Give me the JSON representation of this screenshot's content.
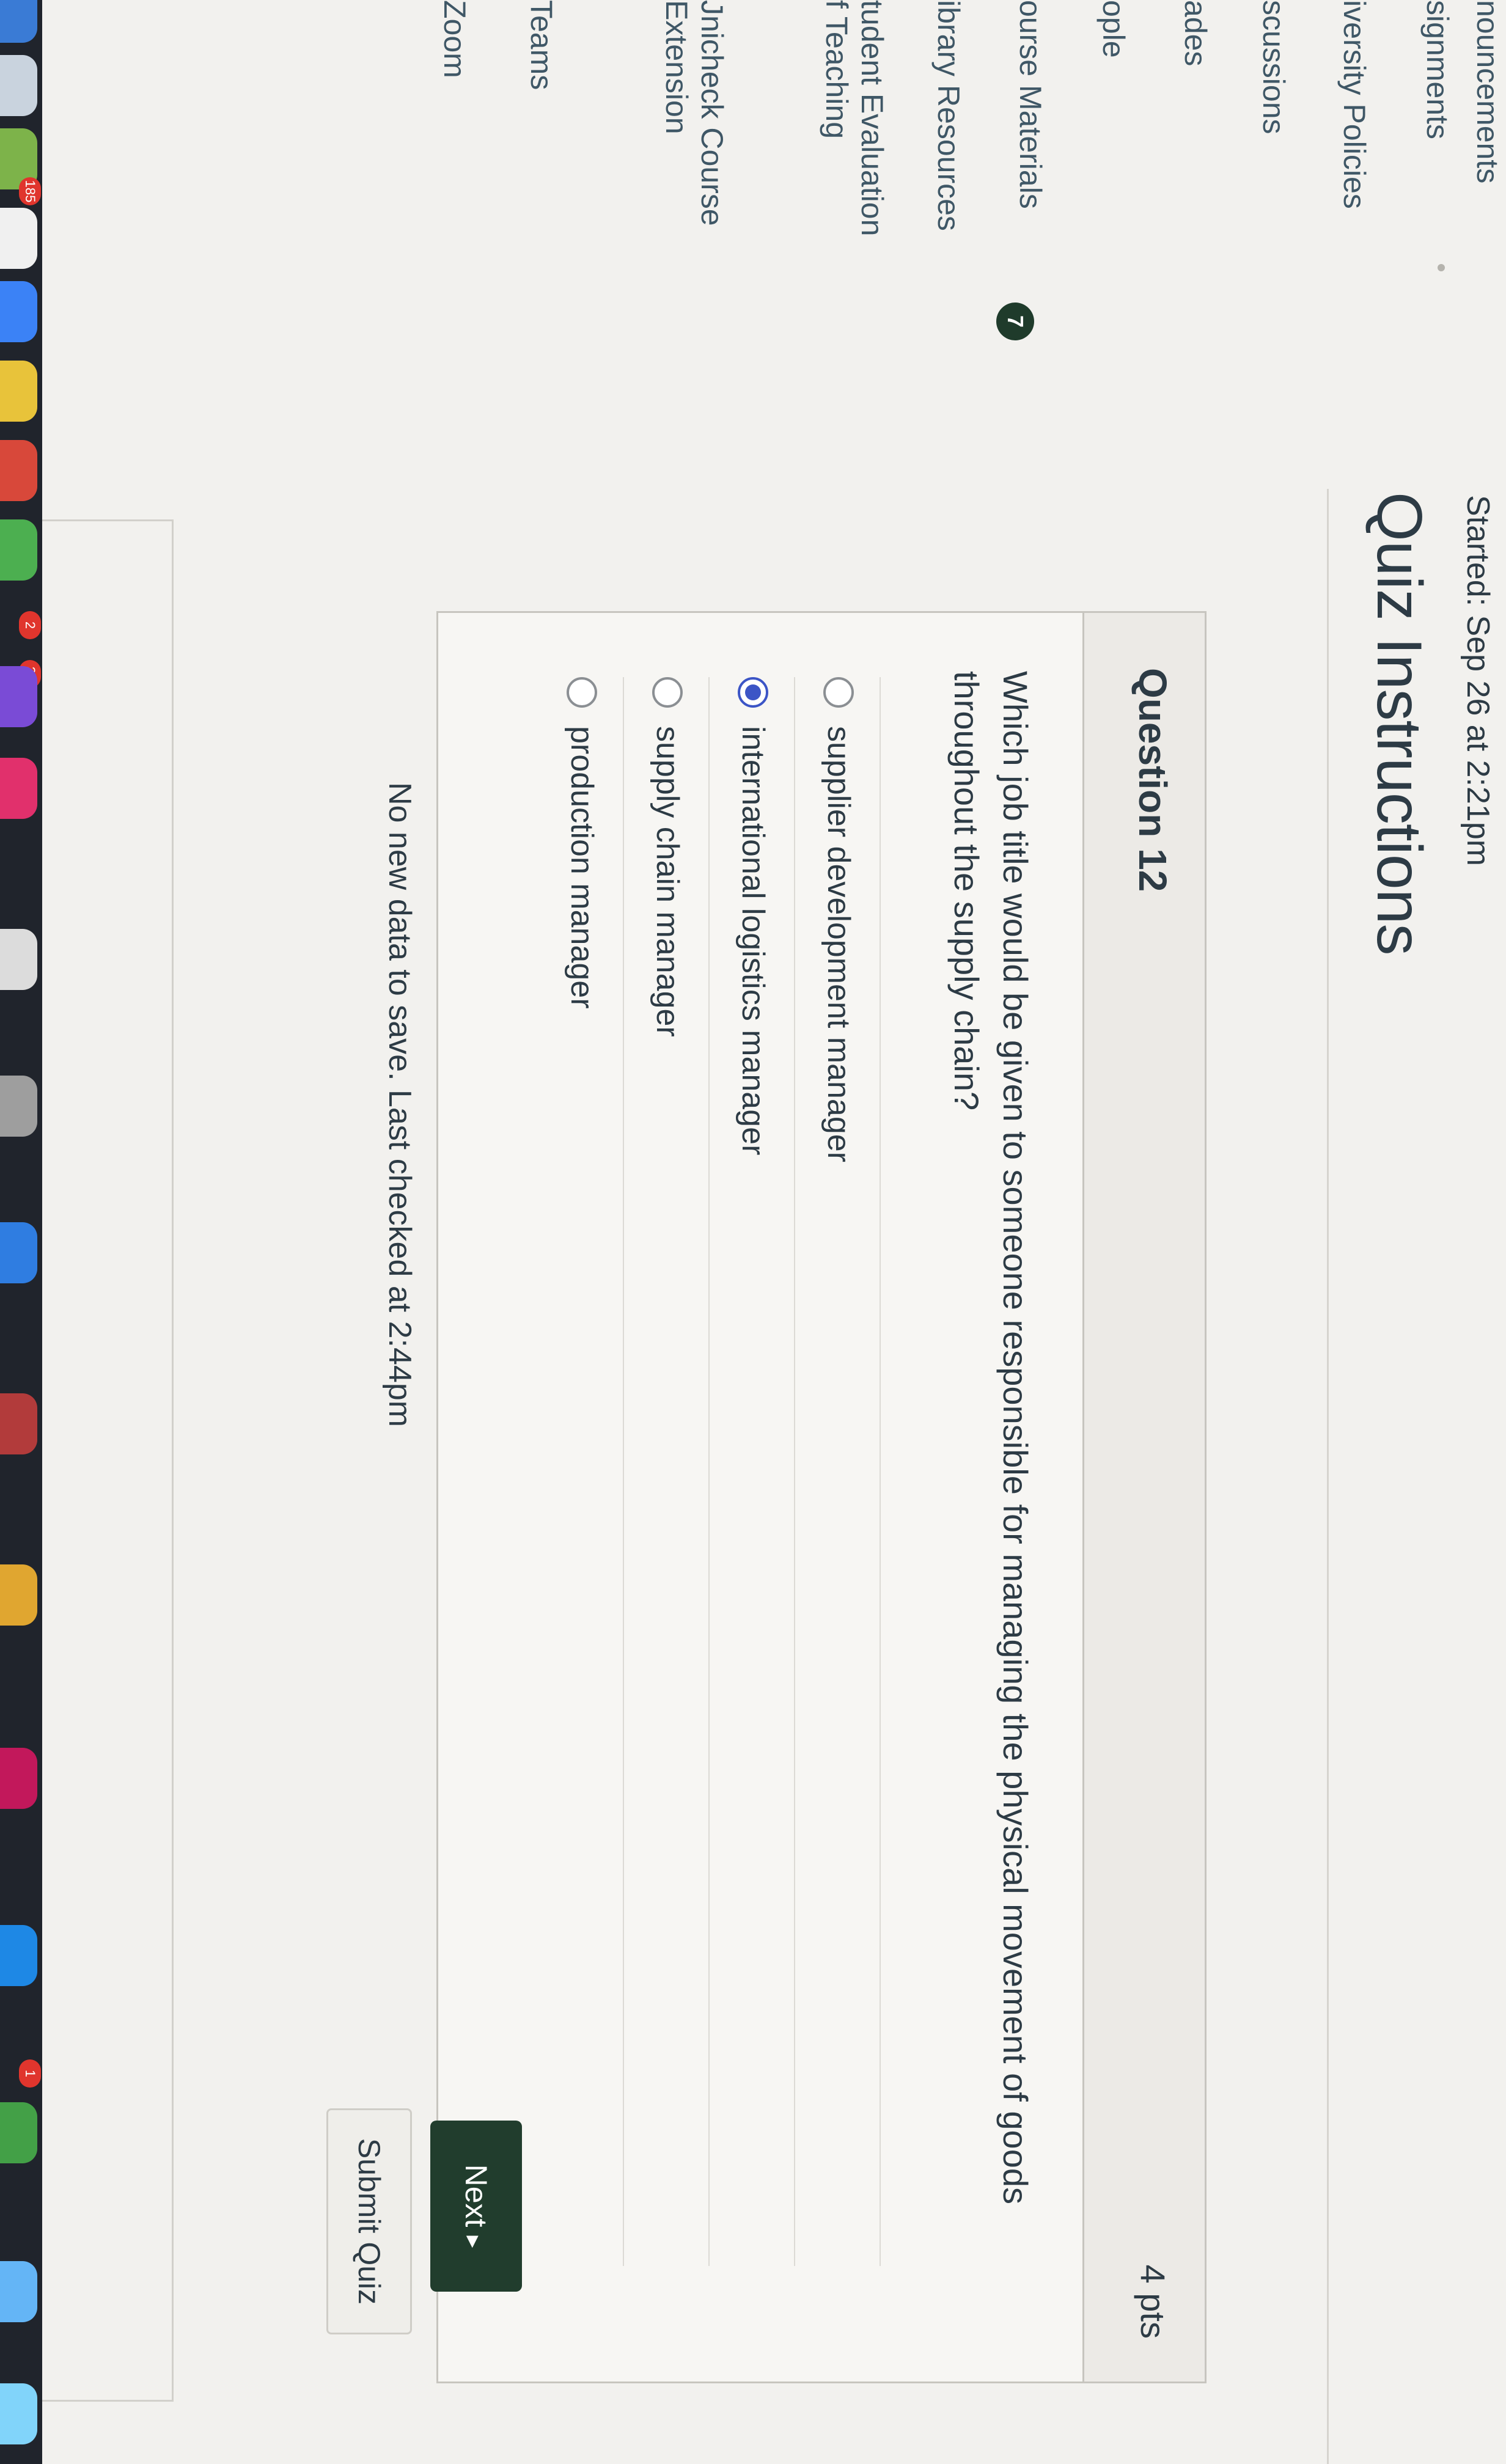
{
  "course_nav": {
    "items": [
      {
        "label": "nouncements"
      },
      {
        "label": "signments"
      },
      {
        "label": "iversity Policies"
      },
      {
        "label": "scussions"
      },
      {
        "label": "ades",
        "badge": "7"
      },
      {
        "label": "ople"
      },
      {
        "label": "ourse Materials"
      },
      {
        "label": "ibrary Resources"
      },
      {
        "label": "tudent Evaluation",
        "label_line2": "f Teaching"
      },
      {
        "label": "Jnicheck Course",
        "label_line2": "Extension"
      },
      {
        "label": "Teams"
      },
      {
        "label": "Zoom"
      }
    ]
  },
  "quiz": {
    "started": "Started: Sep 26 at 2:21pm",
    "title": "Quiz Instructions"
  },
  "question": {
    "number_label": "Question 12",
    "points": "4 pts",
    "text": "Which job title would be given to someone responsible for managing the physical movement of goods throughout the supply chain?",
    "answers": [
      {
        "label": "supplier development manager",
        "selected": false
      },
      {
        "label": "international logistics manager",
        "selected": true
      },
      {
        "label": "supply chain manager",
        "selected": false
      },
      {
        "label": "production manager",
        "selected": false
      }
    ]
  },
  "footer": {
    "save_status": "No new data to save. Last checked at 2:44pm",
    "next_label": "Next",
    "submit_label": "Submit Quiz"
  },
  "dock": {
    "badges": [
      "185",
      "2",
      "37",
      "1"
    ]
  },
  "colors": {
    "accent_dark_green": "#213d2d",
    "radio_selected": "#3c55c6",
    "text": "#2d3b45"
  }
}
